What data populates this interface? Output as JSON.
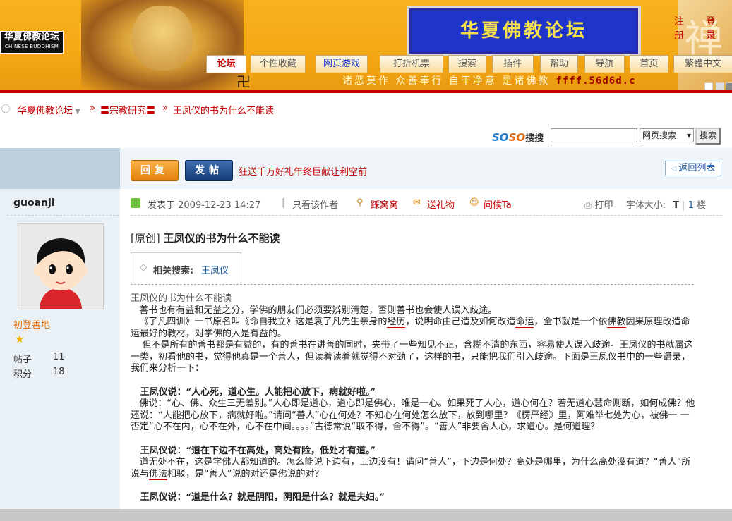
{
  "banner": {
    "logo_cn": "华夏佛教论坛",
    "logo_en": "CHINESE BUDDHISM",
    "site_title": "华夏佛教论坛",
    "right_glyph": "禅",
    "ticker": "诸恶莫作 众善奉行 自干净意 是诸佛教",
    "ticker_url": "ffff.56d6d.c"
  },
  "toplinks": {
    "register": "注册",
    "login": "登录"
  },
  "nav": [
    "论坛",
    "个性收藏",
    "网页游戏",
    "打折机票",
    "搜索",
    "插件",
    "帮助",
    "导航",
    "首页",
    "繁體中文"
  ],
  "breadcrumb": {
    "home": "华夏佛教论坛",
    "section": "〓宗教研究〓",
    "thread": "王凤仪的书为什么不能读",
    "sep": "»"
  },
  "search": {
    "brand1": "SO",
    "brand2": "SO",
    "brand3": "搜搜",
    "value": "",
    "scope": "网页搜索",
    "button": "搜索"
  },
  "toolbar": {
    "reply": "回复",
    "new_post": "发帖",
    "promo": "狂送千万好礼年终巨献让利空前",
    "back": "返回列表"
  },
  "user": {
    "name": "guoanji",
    "rank": "初登善地",
    "posts_label": "帖子",
    "posts": "11",
    "points_label": "积分",
    "points": "18"
  },
  "post_meta": {
    "posted": "发表于 2009-12-23 14:27",
    "only_author": "只看该作者",
    "kick": "踩窝窝",
    "gift": "送礼物",
    "greet": "问候Ta",
    "print": "打印",
    "font_size": "字体大小:",
    "font_t": "T",
    "floor_num": "1",
    "floor_label": "楼"
  },
  "post": {
    "title_prefix": "[原创]",
    "title": "王凤仪的书为什么不能读",
    "tag_label": "相关搜索:",
    "tag_value": "王凤仪",
    "subtitle": "王凤仪的书为什么不能读",
    "p1": "善书也有有益和无益之分，学佛的朋友们必须要辨别清楚，否则善书也会使人误入歧途。",
    "p2a": "《了凡四训》一书原名叫《命自我立》这是袁了凡先生亲身的",
    "p2b": "经历",
    "p2c": "，说明命由己造及如何改造",
    "p2d": "命运",
    "p2e": "，全书就是一个依",
    "p2f": "佛教",
    "p2g": "因果原理改造命运最好的教材，对学佛的人是有益的。",
    "p3": "但不是所有的善书都是有益的，有的善书在讲善的同时，夹带了一些知见不正，含糊不清的东西，容易使人误入歧途。王凤仪的书就属这一类，初看他的书，觉得他真是一个善人，但读着读着就觉得不对劲了，这样的书，只能把我们引入歧途。下面是王凤仪书中的一些语录，我们来分析一下：",
    "h1": "王凤仪说：“人心死，道心生。人能把心放下，病就好啦。”",
    "p4": "佛说：“心、佛、众生三无差别。”人心即是道心，道心即是佛心，唯是一心。如果死了人心，道心何在？若无道心慧命则断，如何成佛？他还说：“人能把心放下，病就好啦。”请问“善人”心在何处？不知心在何处怎么放下，放到哪里？《楞严经》里，阿难举七处为心，被佛一 一否定“心不在内，心不在外，心不在中间。。。。”古德常说“取不得，舍不得”。“善人”非要舍人心，求道心。是何道理？",
    "h2": "王凤仪说：“道在下边不在高处，高处有险，低处才有道。”",
    "p5a": "道无处不在，这是学佛人都知道的。怎么能说下边有，上边没有！请问“善人”，下边是何处？高处是哪里，为什么高处没有道？“善人”所说与",
    "p5b": "佛法",
    "p5c": "相驳，是“善人”说的对还是佛说的对？",
    "h3": "王凤仪说：“道是什么？就是阴阳，阴阳是什么？就是夫妇。”"
  }
}
